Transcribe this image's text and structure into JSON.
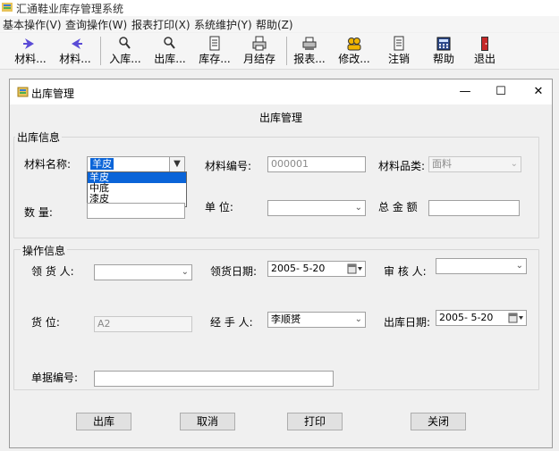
{
  "app": {
    "title": "汇通鞋业库存管理系统",
    "menu": [
      "基本操作(V)",
      "查询操作(W)",
      "报表打印(X)",
      "系统维护(Y)",
      "帮助(Z)"
    ],
    "toolbar": [
      "材料...",
      "材料...",
      "入库...",
      "出库...",
      "库存...",
      "月结存",
      "报表...",
      "修改...",
      "注销",
      "帮助",
      "退出"
    ]
  },
  "window": {
    "title": "出库管理",
    "controls": {
      "minimize": "—",
      "maximize": "☐",
      "close": "✕"
    }
  },
  "form": {
    "heading": "出库管理",
    "outbound_group": "出库信息",
    "operation_group": "操作信息",
    "material_name_label": "材料名称:",
    "material_name_value": "羊皮",
    "material_name_options": [
      "羊皮",
      "中底",
      "漆皮"
    ],
    "material_code_label": "材料编号:",
    "material_code_value": "000001",
    "material_category_label": "材料品类:",
    "material_category_value": "面料",
    "quantity_label": "数  量:",
    "unit_label": "单  位:",
    "unit_value": "",
    "total_label": "总 金 额",
    "total_value": "",
    "receiver_label": "领 货 人:",
    "receiver_value": "",
    "receive_date_label": "领货日期:",
    "receive_date_value": "2005- 5-20",
    "reviewer_label": "审 核 人:",
    "reviewer_value": "",
    "location_label": "货  位:",
    "location_value": "A2",
    "handler_label": "经 手 人:",
    "handler_value": "李顺赟",
    "outbound_date_label": "出库日期:",
    "outbound_date_value": "2005- 5-20",
    "doc_no_label": "单据编号:",
    "doc_no_value": ""
  },
  "buttons": {
    "outbound": "出库",
    "cancel": "取消",
    "print": "打印",
    "close": "关闭"
  }
}
